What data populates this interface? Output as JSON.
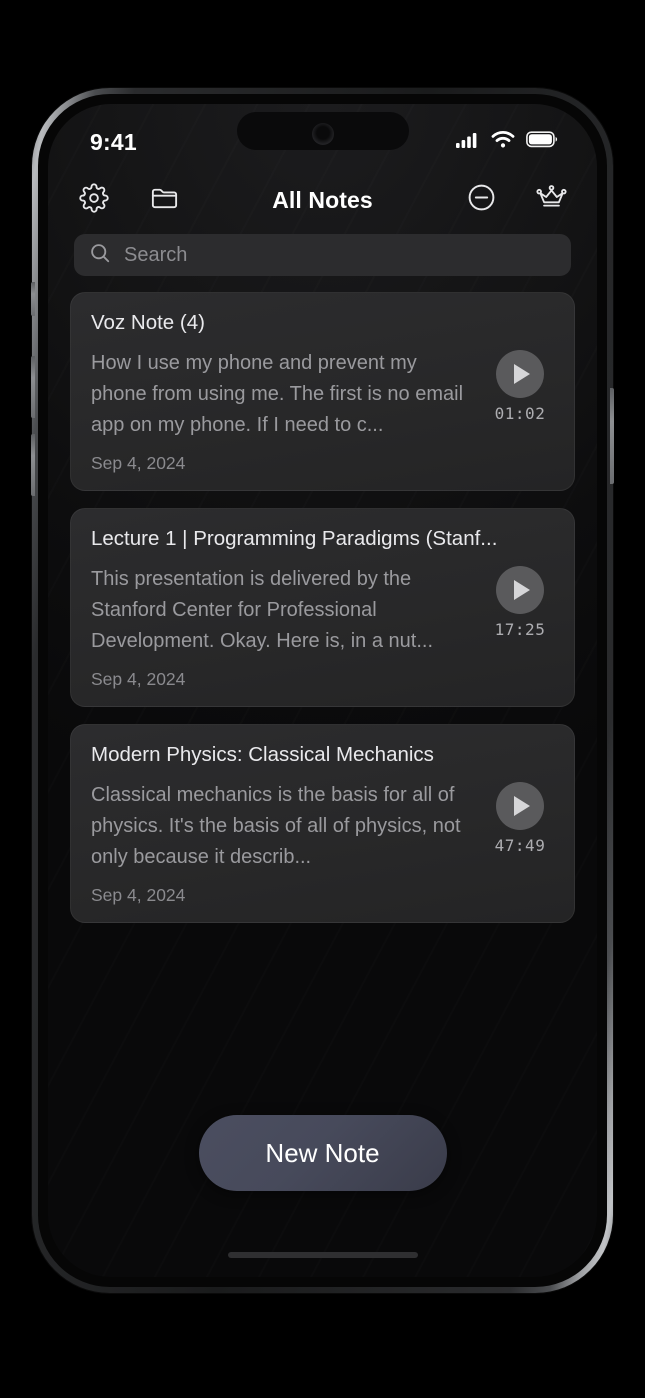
{
  "status_bar": {
    "time": "9:41",
    "cellular_icon": "cellular-signal-icon",
    "wifi_icon": "wifi-icon",
    "battery_icon": "battery-full-icon"
  },
  "nav_bar": {
    "title": "All Notes",
    "settings_icon": "gear-icon",
    "folder_icon": "folder-icon",
    "minus_circle_icon": "minus-circle-icon",
    "crown_icon": "crown-icon"
  },
  "search": {
    "placeholder": "Search",
    "value": "",
    "icon": "search-icon"
  },
  "notes": [
    {
      "title": "Voz Note (4)",
      "snippet": "How I use my phone and prevent my phone from using me. The first is no email app on my phone. If I need to c...",
      "duration": "01:02",
      "date": "Sep 4, 2024",
      "play_icon": "play-icon"
    },
    {
      "title": "Lecture 1 | Programming Paradigms (Stanf...",
      "snippet": "This presentation is delivered by the Stanford Center for Professional Development. Okay. Here is, in a nut...",
      "duration": "17:25",
      "date": "Sep 4, 2024",
      "play_icon": "play-icon"
    },
    {
      "title": "Modern Physics: Classical Mechanics",
      "snippet": "Classical mechanics is the basis for all of physics. It's the basis of all of physics, not only because it describ...",
      "duration": "47:49",
      "date": "Sep 4, 2024",
      "play_icon": "play-icon"
    }
  ],
  "new_note_button": {
    "label": "New Note"
  },
  "colors": {
    "screen_background": "#141415",
    "card_background": "#2c2c2e",
    "search_background": "#2c2c2e",
    "play_button": "#5a5a5c",
    "new_note_gradient_start": "#4b4e60",
    "new_note_gradient_end": "#3a3c4a",
    "title_text": "#e9e9ec",
    "body_text": "#9a9a9e",
    "date_text": "#8a8a8e"
  }
}
